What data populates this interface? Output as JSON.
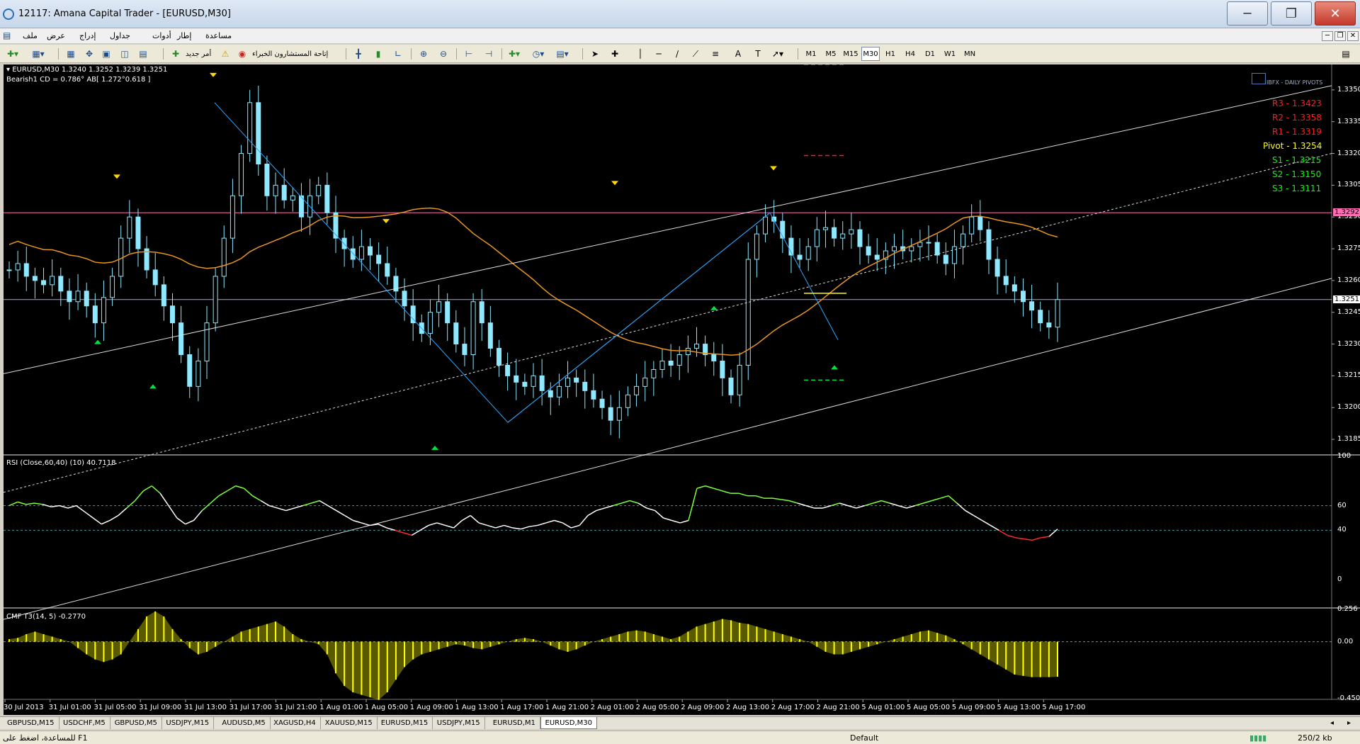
{
  "window": {
    "title": "12117: Amana Capital Trader - [EURUSD,M30]"
  },
  "menu": [
    "مساعدة",
    "إطار",
    "أدوات",
    "جداول",
    "إدراج",
    "عرض",
    "ملف"
  ],
  "toolbar": {
    "new_order": "أمر جديد",
    "expert_advisors": "إتاحة المستشارون الخبراء",
    "timeframes": [
      "M1",
      "M5",
      "M15",
      "M30",
      "H1",
      "H4",
      "D1",
      "W1",
      "MN"
    ],
    "active_timeframe": "M30"
  },
  "chart": {
    "symbol_info": "EURUSD,M30  1.3240 1.3252 1.3239 1.3251",
    "pattern_info": "Bearish1 CD = 0.786° AB[ 1.272°0.618 ]",
    "pivot_header": "IBFX - DAILY PIVOTS",
    "pivots": [
      {
        "label": "R3 - 1.3423",
        "color": "#ff1e1e"
      },
      {
        "label": "R2 - 1.3358",
        "color": "#ff1e1e"
      },
      {
        "label": "R1 - 1.3319",
        "color": "#ff1e1e"
      },
      {
        "label": "Pivot - 1.3254",
        "color": "#ffff00"
      },
      {
        "label": "S1 - 1.3215",
        "color": "#00ff00"
      },
      {
        "label": "S2 - 1.3150",
        "color": "#00ff00"
      },
      {
        "label": "S3 - 1.3111",
        "color": "#00ff00"
      }
    ],
    "price_labels": [
      "1.3350",
      "1.3335",
      "1.3320",
      "1.3305",
      "1.3290",
      "1.3275",
      "1.3260",
      "1.3245",
      "1.3230",
      "1.3215",
      "1.3200",
      "1.3185"
    ],
    "marker_pink": "1.3292",
    "marker_current": "1.3251",
    "time_labels": [
      "30 Jul 2013",
      "31 Jul 01:00",
      "31 Jul 05:00",
      "31 Jul 09:00",
      "31 Jul 13:00",
      "31 Jul 17:00",
      "31 Jul 21:00",
      "1 Aug 01:00",
      "1 Aug 05:00",
      "1 Aug 09:00",
      "1 Aug 13:00",
      "1 Aug 17:00",
      "1 Aug 21:00",
      "2 Aug 01:00",
      "2 Aug 05:00",
      "2 Aug 09:00",
      "2 Aug 13:00",
      "2 Aug 17:00",
      "2 Aug 21:00",
      "5 Aug 01:00",
      "5 Aug 05:00",
      "5 Aug 09:00",
      "5 Aug 13:00",
      "5 Aug 17:00"
    ],
    "close_series": [
      1.3265,
      1.3268,
      1.3262,
      1.326,
      1.3258,
      1.3262,
      1.3255,
      1.325,
      1.3255,
      1.3248,
      1.324,
      1.3252,
      1.3262,
      1.328,
      1.329,
      1.3275,
      1.3265,
      1.3258,
      1.3248,
      1.324,
      1.3225,
      1.321,
      1.3222,
      1.324,
      1.3262,
      1.328,
      1.33,
      1.332,
      1.3344,
      1.3315,
      1.33,
      1.3305,
      1.3298,
      1.33,
      1.329,
      1.33,
      1.3305,
      1.3292,
      1.328,
      1.3275,
      1.327,
      1.3276,
      1.3272,
      1.3268,
      1.3262,
      1.3255,
      1.3248,
      1.324,
      1.3235,
      1.3245,
      1.325,
      1.324,
      1.323,
      1.3225,
      1.325,
      1.324,
      1.3228,
      1.322,
      1.3215,
      1.3212,
      1.321,
      1.3215,
      1.3208,
      1.3205,
      1.321,
      1.3214,
      1.3212,
      1.3208,
      1.3204,
      1.32,
      1.3194,
      1.32,
      1.3206,
      1.321,
      1.3214,
      1.3218,
      1.3222,
      1.322,
      1.3225,
      1.3228,
      1.323,
      1.3225,
      1.3222,
      1.3214,
      1.3206,
      1.322,
      1.327,
      1.3282,
      1.329,
      1.3288,
      1.328,
      1.3272,
      1.327,
      1.3276,
      1.3284,
      1.3285,
      1.328,
      1.3282,
      1.3284,
      1.3276,
      1.3272,
      1.327,
      1.3274,
      1.3276,
      1.3274,
      1.3276,
      1.3278,
      1.3278,
      1.3272,
      1.3268,
      1.3276,
      1.3282,
      1.329,
      1.3284,
      1.327,
      1.3262,
      1.3258,
      1.3255,
      1.325,
      1.3246,
      1.324,
      1.3238,
      1.3251
    ],
    "rsi": {
      "label": "RSI (Close,60,40) (10) 40.7118",
      "levels": [
        "100",
        "60",
        "40",
        "0"
      ],
      "values": [
        60,
        63,
        61,
        62,
        61,
        59,
        60,
        58,
        60,
        55,
        50,
        45,
        48,
        52,
        58,
        64,
        72,
        76,
        70,
        60,
        50,
        45,
        48,
        56,
        62,
        68,
        72,
        76,
        74,
        68,
        64,
        60,
        58,
        56,
        58,
        60,
        62,
        64,
        60,
        56,
        52,
        48,
        46,
        44,
        45,
        42,
        40,
        38,
        36,
        40,
        44,
        46,
        44,
        42,
        48,
        52,
        46,
        44,
        42,
        44,
        42,
        41,
        43,
        44,
        46,
        48,
        46,
        42,
        44,
        52,
        56,
        58,
        60,
        62,
        64,
        62,
        58,
        56,
        50,
        48,
        46,
        48,
        74,
        76,
        74,
        72,
        70,
        70,
        68,
        68,
        66,
        66,
        65,
        64,
        62,
        60,
        58,
        58,
        60,
        62,
        60,
        58,
        60,
        62,
        64,
        62,
        60,
        58,
        60,
        62,
        64,
        66,
        68,
        62,
        56,
        52,
        48,
        44,
        40,
        36,
        34,
        33,
        32,
        34,
        35,
        41
      ],
      "value": 40.7118
    },
    "cmf": {
      "label": "CMF T3(14, 5) -0.2770",
      "levels": [
        "0.256",
        "0.00",
        "-0.4504"
      ],
      "values": [
        0.02,
        0.03,
        0.06,
        0.08,
        0.06,
        0.04,
        0.02,
        0.0,
        -0.05,
        -0.1,
        -0.14,
        -0.16,
        -0.14,
        -0.1,
        0.0,
        0.1,
        0.2,
        0.24,
        0.2,
        0.1,
        0.02,
        -0.05,
        -0.1,
        -0.08,
        -0.04,
        0.0,
        0.04,
        0.08,
        0.1,
        0.12,
        0.14,
        0.16,
        0.12,
        0.06,
        0.02,
        0.0,
        -0.02,
        -0.1,
        -0.25,
        -0.35,
        -0.4,
        -0.42,
        -0.44,
        -0.46,
        -0.4,
        -0.3,
        -0.2,
        -0.14,
        -0.1,
        -0.08,
        -0.06,
        -0.04,
        -0.02,
        -0.03,
        -0.05,
        -0.06,
        -0.04,
        -0.02,
        0.0,
        0.02,
        0.03,
        0.02,
        0.0,
        -0.03,
        -0.06,
        -0.08,
        -0.06,
        -0.03,
        0.0,
        0.02,
        0.04,
        0.06,
        0.08,
        0.09,
        0.08,
        0.06,
        0.04,
        0.02,
        0.04,
        0.08,
        0.12,
        0.14,
        0.16,
        0.18,
        0.17,
        0.15,
        0.14,
        0.12,
        0.1,
        0.08,
        0.06,
        0.04,
        0.02,
        0.0,
        -0.04,
        -0.08,
        -0.1,
        -0.1,
        -0.08,
        -0.06,
        -0.04,
        -0.02,
        0.0,
        0.02,
        0.04,
        0.06,
        0.08,
        0.09,
        0.07,
        0.05,
        0.02,
        -0.02,
        -0.06,
        -0.1,
        -0.14,
        -0.18,
        -0.22,
        -0.26,
        -0.27,
        -0.28,
        -0.28,
        -0.28,
        -0.277
      ],
      "value": -0.277
    }
  },
  "tabs": [
    "GBPUSD,M15",
    "USDCHF,M5",
    "GBPUSD,M5",
    "USDJPY,M15",
    "AUDUSD,M5",
    "XAGUSD,H4",
    "XAUUSD,M15",
    "EURUSD,M15",
    "USDJPY,M15",
    "EURUSD,M1",
    "EURUSD,M30"
  ],
  "active_tab": "EURUSD,M30",
  "status": {
    "help": "للمساعدة، اضغط على F1",
    "profile": "Default",
    "traffic": "250/2 kb"
  }
}
